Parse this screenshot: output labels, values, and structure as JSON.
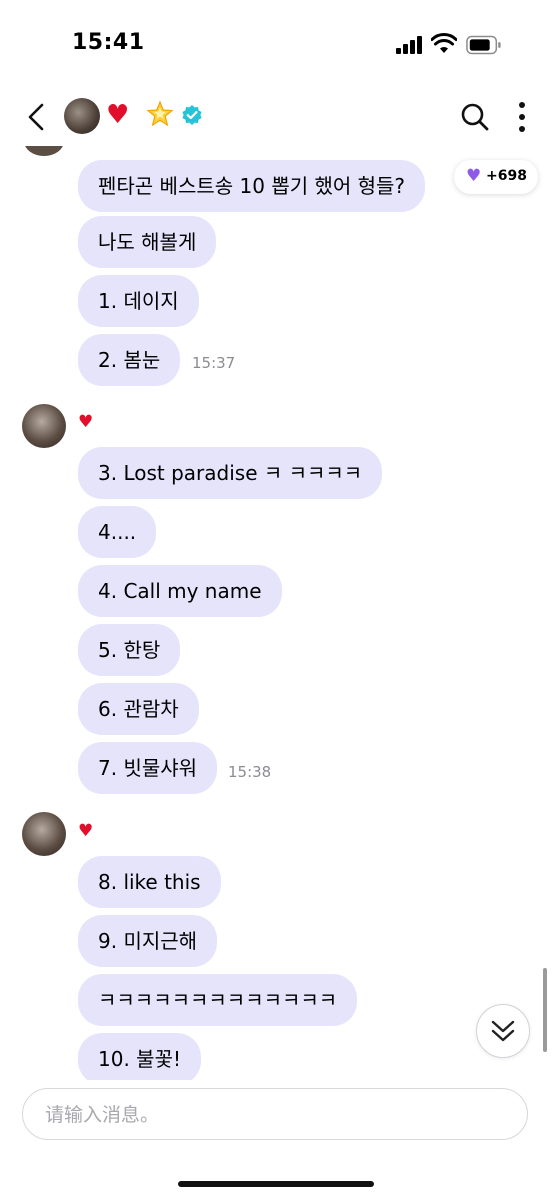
{
  "status": {
    "time": "15:41"
  },
  "header": {
    "icons": [
      "back-icon",
      "avatar",
      "heart-icon",
      "star-icon",
      "verified-badge-icon",
      "search-icon",
      "more-icon"
    ]
  },
  "reaction": {
    "count": "+698",
    "icon": "purple-heart-icon",
    "color": "#8e5be6"
  },
  "messages": [
    {
      "text": "펜타곤 베스트송 10 뽑기 했어 형들?"
    },
    {
      "text": "나도 해볼게"
    },
    {
      "text": "1. 데이지"
    },
    {
      "text": "2. 봄눈",
      "time": "15:37"
    },
    {
      "text": "3. Lost paradise ㅋ ㅋㅋㅋㅋ"
    },
    {
      "text": "4...."
    },
    {
      "text": "4. Call my name"
    },
    {
      "text": "5. 한탕"
    },
    {
      "text": "6. 관람차"
    },
    {
      "text": "7. 빗물샤워",
      "time": "15:38"
    },
    {
      "text": "8. like this"
    },
    {
      "text": "9. 미지근해"
    },
    {
      "text": "ㅋㅋㅋㅋㅋㅋㅋㅋㅋㅋㅋㅋㅋ"
    },
    {
      "text": "10. 불꽃!"
    }
  ],
  "sender": {
    "heart": "♥",
    "heart_color": "#e0102d"
  },
  "bubble_color": "#e5e4fb",
  "input": {
    "placeholder": "请输入消息。"
  }
}
